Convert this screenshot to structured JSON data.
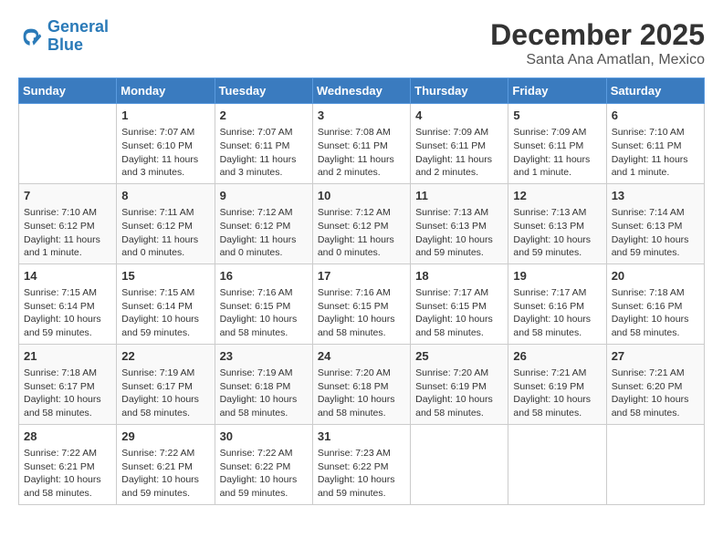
{
  "logo": {
    "line1": "General",
    "line2": "Blue"
  },
  "title": "December 2025",
  "subtitle": "Santa Ana Amatlan, Mexico",
  "days_of_week": [
    "Sunday",
    "Monday",
    "Tuesday",
    "Wednesday",
    "Thursday",
    "Friday",
    "Saturday"
  ],
  "weeks": [
    [
      {
        "day": "",
        "info": ""
      },
      {
        "day": "1",
        "info": "Sunrise: 7:07 AM\nSunset: 6:10 PM\nDaylight: 11 hours\nand 3 minutes."
      },
      {
        "day": "2",
        "info": "Sunrise: 7:07 AM\nSunset: 6:11 PM\nDaylight: 11 hours\nand 3 minutes."
      },
      {
        "day": "3",
        "info": "Sunrise: 7:08 AM\nSunset: 6:11 PM\nDaylight: 11 hours\nand 2 minutes."
      },
      {
        "day": "4",
        "info": "Sunrise: 7:09 AM\nSunset: 6:11 PM\nDaylight: 11 hours\nand 2 minutes."
      },
      {
        "day": "5",
        "info": "Sunrise: 7:09 AM\nSunset: 6:11 PM\nDaylight: 11 hours\nand 1 minute."
      },
      {
        "day": "6",
        "info": "Sunrise: 7:10 AM\nSunset: 6:11 PM\nDaylight: 11 hours\nand 1 minute."
      }
    ],
    [
      {
        "day": "7",
        "info": "Sunrise: 7:10 AM\nSunset: 6:12 PM\nDaylight: 11 hours\nand 1 minute."
      },
      {
        "day": "8",
        "info": "Sunrise: 7:11 AM\nSunset: 6:12 PM\nDaylight: 11 hours\nand 0 minutes."
      },
      {
        "day": "9",
        "info": "Sunrise: 7:12 AM\nSunset: 6:12 PM\nDaylight: 11 hours\nand 0 minutes."
      },
      {
        "day": "10",
        "info": "Sunrise: 7:12 AM\nSunset: 6:12 PM\nDaylight: 11 hours\nand 0 minutes."
      },
      {
        "day": "11",
        "info": "Sunrise: 7:13 AM\nSunset: 6:13 PM\nDaylight: 10 hours\nand 59 minutes."
      },
      {
        "day": "12",
        "info": "Sunrise: 7:13 AM\nSunset: 6:13 PM\nDaylight: 10 hours\nand 59 minutes."
      },
      {
        "day": "13",
        "info": "Sunrise: 7:14 AM\nSunset: 6:13 PM\nDaylight: 10 hours\nand 59 minutes."
      }
    ],
    [
      {
        "day": "14",
        "info": "Sunrise: 7:15 AM\nSunset: 6:14 PM\nDaylight: 10 hours\nand 59 minutes."
      },
      {
        "day": "15",
        "info": "Sunrise: 7:15 AM\nSunset: 6:14 PM\nDaylight: 10 hours\nand 59 minutes."
      },
      {
        "day": "16",
        "info": "Sunrise: 7:16 AM\nSunset: 6:15 PM\nDaylight: 10 hours\nand 58 minutes."
      },
      {
        "day": "17",
        "info": "Sunrise: 7:16 AM\nSunset: 6:15 PM\nDaylight: 10 hours\nand 58 minutes."
      },
      {
        "day": "18",
        "info": "Sunrise: 7:17 AM\nSunset: 6:15 PM\nDaylight: 10 hours\nand 58 minutes."
      },
      {
        "day": "19",
        "info": "Sunrise: 7:17 AM\nSunset: 6:16 PM\nDaylight: 10 hours\nand 58 minutes."
      },
      {
        "day": "20",
        "info": "Sunrise: 7:18 AM\nSunset: 6:16 PM\nDaylight: 10 hours\nand 58 minutes."
      }
    ],
    [
      {
        "day": "21",
        "info": "Sunrise: 7:18 AM\nSunset: 6:17 PM\nDaylight: 10 hours\nand 58 minutes."
      },
      {
        "day": "22",
        "info": "Sunrise: 7:19 AM\nSunset: 6:17 PM\nDaylight: 10 hours\nand 58 minutes."
      },
      {
        "day": "23",
        "info": "Sunrise: 7:19 AM\nSunset: 6:18 PM\nDaylight: 10 hours\nand 58 minutes."
      },
      {
        "day": "24",
        "info": "Sunrise: 7:20 AM\nSunset: 6:18 PM\nDaylight: 10 hours\nand 58 minutes."
      },
      {
        "day": "25",
        "info": "Sunrise: 7:20 AM\nSunset: 6:19 PM\nDaylight: 10 hours\nand 58 minutes."
      },
      {
        "day": "26",
        "info": "Sunrise: 7:21 AM\nSunset: 6:19 PM\nDaylight: 10 hours\nand 58 minutes."
      },
      {
        "day": "27",
        "info": "Sunrise: 7:21 AM\nSunset: 6:20 PM\nDaylight: 10 hours\nand 58 minutes."
      }
    ],
    [
      {
        "day": "28",
        "info": "Sunrise: 7:22 AM\nSunset: 6:21 PM\nDaylight: 10 hours\nand 58 minutes."
      },
      {
        "day": "29",
        "info": "Sunrise: 7:22 AM\nSunset: 6:21 PM\nDaylight: 10 hours\nand 59 minutes."
      },
      {
        "day": "30",
        "info": "Sunrise: 7:22 AM\nSunset: 6:22 PM\nDaylight: 10 hours\nand 59 minutes."
      },
      {
        "day": "31",
        "info": "Sunrise: 7:23 AM\nSunset: 6:22 PM\nDaylight: 10 hours\nand 59 minutes."
      },
      {
        "day": "",
        "info": ""
      },
      {
        "day": "",
        "info": ""
      },
      {
        "day": "",
        "info": ""
      }
    ]
  ]
}
